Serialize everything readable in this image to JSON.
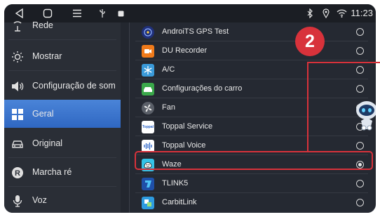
{
  "statusbar": {
    "time": "11:23",
    "icons": [
      "back-icon",
      "home-icon",
      "menu-icon",
      "usb-icon",
      "photo-icon",
      "bluetooth-icon",
      "location-icon",
      "wifi-icon"
    ]
  },
  "sidebar": {
    "items": [
      {
        "label": "Rede",
        "icon": "network-icon"
      },
      {
        "label": "Mostrar",
        "icon": "brightness-icon"
      },
      {
        "label": "Configuração de som",
        "icon": "speaker-icon"
      },
      {
        "label": "Geral",
        "icon": "grid-icon",
        "active": true
      },
      {
        "label": "Original",
        "icon": "car-icon"
      },
      {
        "label": "Marcha ré",
        "icon": "reverse-icon"
      },
      {
        "label": "Voz",
        "icon": "microphone-icon"
      }
    ]
  },
  "apps": [
    {
      "label": "AndroiTS GPS Test",
      "selected": false,
      "color": "#20307a"
    },
    {
      "label": "DU Recorder",
      "selected": false,
      "color": "#f07a1a"
    },
    {
      "label": "A/C",
      "selected": false,
      "color": "#3a9ad9"
    },
    {
      "label": "Configurações do carro",
      "selected": false,
      "color": "#3aa84a"
    },
    {
      "label": "Fan",
      "selected": false,
      "color": "#5a5f68"
    },
    {
      "label": "Toppal Service",
      "selected": false,
      "color": "#2a63c8"
    },
    {
      "label": "Toppal Voice",
      "selected": false,
      "color": "#2a63c8"
    },
    {
      "label": "Waze",
      "selected": true,
      "color": "#34c3e8"
    },
    {
      "label": "TLINK5",
      "selected": false,
      "color": "#2a80d8"
    },
    {
      "label": "CarbitLink",
      "selected": false,
      "color": "#2d9be0"
    }
  ],
  "annotation": {
    "number": "2",
    "color": "#d8323b"
  }
}
